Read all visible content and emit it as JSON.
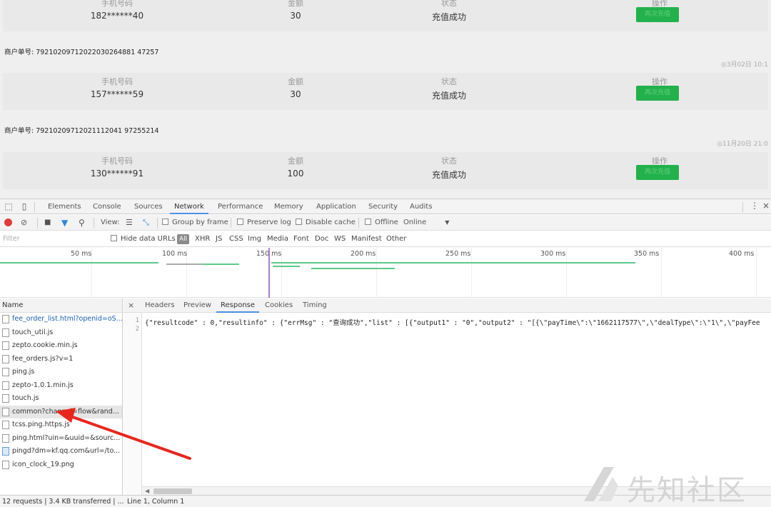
{
  "orders": [
    {
      "order_no": "",
      "time": "",
      "headers": [
        "手机号码",
        "金额",
        "状态",
        "操作"
      ],
      "phone": "182******40",
      "amount": "30",
      "status": "充值成功",
      "action_label": "再次充值"
    },
    {
      "order_no": "商户单号: 79210209712022030264881 47257",
      "time": "◎3月02日 10:1",
      "headers": [
        "手机号码",
        "金额",
        "状态",
        "操作"
      ],
      "phone": "157******59",
      "amount": "30",
      "status": "充值成功",
      "action_label": "再次充值"
    },
    {
      "order_no": "商户单号: 79210209712021112041 97255214",
      "time": "◎11月20日 21:0",
      "headers": [
        "手机号码",
        "金额",
        "状态",
        "操作"
      ],
      "phone": "130******91",
      "amount": "100",
      "status": "充值成功",
      "action_label": "再次充值"
    }
  ],
  "devtools": {
    "tabs": [
      "Elements",
      "Console",
      "Sources",
      "Network",
      "Performance",
      "Memory",
      "Application",
      "Security",
      "Audits"
    ],
    "active_tab": "Network",
    "toolbar": {
      "view_label": "View:",
      "group_by_frame": "Group by frame",
      "preserve_log": "Preserve log",
      "disable_cache": "Disable cache",
      "offline": "Offline",
      "online": "Online"
    },
    "filter": {
      "placeholder": "Filter",
      "hide_data_urls": "Hide data URLs",
      "types": [
        "All",
        "XHR",
        "JS",
        "CSS",
        "Img",
        "Media",
        "Font",
        "Doc",
        "WS",
        "Manifest",
        "Other"
      ]
    },
    "timeline_ticks": [
      "50 ms",
      "100 ms",
      "150 ms",
      "200 ms",
      "250 ms",
      "300 ms",
      "350 ms",
      "400 ms"
    ],
    "name_header": "Name",
    "requests": [
      "fee_order_list.html?openid=oS...",
      "touch_util.js",
      "zepto.cookie.min.js",
      "fee_orders.js?v=1",
      "ping.js",
      "zepto-1.0.1.min.js",
      "touch.js",
      "common?channel=flow&rand...",
      "tcss.ping.https.js",
      "ping.html?uin=&uuid=&sourc...",
      "pingd?dm=kf.qq.com&url=/to...",
      "icon_clock_19.png"
    ],
    "selected_request": 7,
    "detail_tabs": [
      "Headers",
      "Preview",
      "Response",
      "Cookies",
      "Timing"
    ],
    "active_detail_tab": "Response",
    "close_glyph": "×",
    "line_numbers": [
      "1",
      "2"
    ],
    "response_body": "{\"resultcode\" : 0,\"resultinfo\" : {\"errMsg\" : \"查询成功\",\"list\" : [{\"output1\" : \"0\",\"output2\" : \"[{\\\"payTime\\\":\\\"1662117577\\\",\\\"dealType\\\":\\\"1\\\",\\\"payFee",
    "status_bar": "12 requests  |  3.4 KB transferred  |  ...",
    "cursor_pos": "Line 1, Column 1"
  },
  "watermark": "先知社区",
  "colors": {
    "success_green": "#22b14c",
    "accent_blue": "#4a90e2",
    "record_red": "#e23b3b",
    "arrow_red": "#e8261d"
  }
}
